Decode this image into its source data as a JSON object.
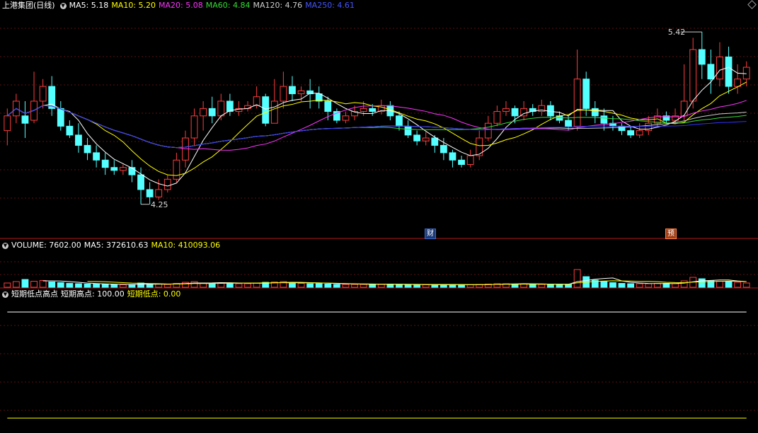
{
  "colors": {
    "up": "#ff3c3c",
    "down": "#54ffff",
    "ma5": "#ffffff",
    "ma10": "#ffff00",
    "ma20": "#ff33ff",
    "ma60": "#33dd33",
    "ma120": "#cccccc",
    "ma250": "#3333ff",
    "grid": "#5a1010",
    "axis": "#b01818"
  },
  "header": {
    "title": "上港集团(日线)",
    "ma5": "MA5: 5.18",
    "ma10": "MA10: 5.20",
    "ma20": "MA20: 5.08",
    "ma60": "MA60: 4.84",
    "ma120": "MA120: 4.76",
    "ma250": "MA250: 4.61"
  },
  "volume_header": {
    "label": "VOLUME: 7602.00",
    "ma5": "MA5: 372610.63",
    "ma10": "MA10: 410093.06"
  },
  "indicator_header": {
    "label": "短期低点高点",
    "high": "短期高点: 100.00",
    "low": "短期低点: 0.00"
  },
  "markers": {
    "cai": "财",
    "yu": "预"
  },
  "chart_data": {
    "type": "candlestick",
    "price_range": [
      4.1,
      5.55
    ],
    "high_label": "5.42",
    "low_label": "4.25",
    "candles": [
      [
        4.75,
        4.85,
        4.65,
        4.9
      ],
      [
        4.85,
        4.95,
        4.8,
        5.0
      ],
      [
        4.85,
        4.8,
        4.7,
        4.95
      ],
      [
        4.82,
        4.95,
        4.8,
        5.15
      ],
      [
        4.95,
        5.05,
        4.9,
        5.1
      ],
      [
        5.05,
        4.9,
        4.85,
        5.12
      ],
      [
        4.9,
        4.78,
        4.75,
        4.95
      ],
      [
        4.78,
        4.72,
        4.7,
        4.82
      ],
      [
        4.72,
        4.65,
        4.6,
        4.8
      ],
      [
        4.65,
        4.6,
        4.55,
        4.7
      ],
      [
        4.6,
        4.55,
        4.5,
        4.65
      ],
      [
        4.55,
        4.5,
        4.45,
        4.6
      ],
      [
        4.5,
        4.48,
        4.45,
        4.55
      ],
      [
        4.48,
        4.5,
        4.45,
        4.52
      ],
      [
        4.5,
        4.45,
        4.4,
        4.55
      ],
      [
        4.45,
        4.35,
        4.25,
        4.5
      ],
      [
        4.35,
        4.3,
        4.25,
        4.4
      ],
      [
        4.3,
        4.35,
        4.28,
        4.42
      ],
      [
        4.35,
        4.42,
        4.33,
        4.45
      ],
      [
        4.42,
        4.55,
        4.4,
        4.6
      ],
      [
        4.55,
        4.7,
        4.5,
        4.75
      ],
      [
        4.7,
        4.85,
        4.65,
        4.9
      ],
      [
        4.85,
        4.9,
        4.75,
        4.95
      ],
      [
        4.9,
        4.85,
        4.8,
        4.98
      ],
      [
        4.85,
        4.95,
        4.82,
        5.0
      ],
      [
        4.95,
        4.88,
        4.85,
        5.0
      ],
      [
        4.88,
        4.9,
        4.85,
        4.95
      ],
      [
        4.9,
        4.92,
        4.88,
        4.95
      ],
      [
        4.92,
        4.98,
        4.9,
        5.05
      ],
      [
        4.98,
        4.8,
        4.78,
        5.0
      ],
      [
        4.8,
        4.95,
        4.8,
        5.1
      ],
      [
        4.95,
        5.05,
        4.9,
        5.15
      ],
      [
        5.05,
        5.0,
        4.95,
        5.12
      ],
      [
        5.0,
        5.02,
        4.95,
        5.05
      ],
      [
        5.02,
        5.0,
        4.9,
        5.1
      ],
      [
        5.0,
        4.95,
        4.9,
        5.05
      ],
      [
        4.95,
        4.88,
        4.82,
        4.98
      ],
      [
        4.88,
        4.82,
        4.8,
        4.9
      ],
      [
        4.82,
        4.85,
        4.8,
        4.88
      ],
      [
        4.85,
        4.88,
        4.82,
        4.92
      ],
      [
        4.88,
        4.9,
        4.85,
        4.95
      ],
      [
        4.9,
        4.88,
        4.85,
        4.93
      ],
      [
        4.88,
        4.92,
        4.86,
        4.96
      ],
      [
        4.92,
        4.85,
        4.82,
        4.95
      ],
      [
        4.85,
        4.78,
        4.75,
        4.88
      ],
      [
        4.78,
        4.72,
        4.7,
        4.82
      ],
      [
        4.72,
        4.68,
        4.65,
        4.75
      ],
      [
        4.68,
        4.7,
        4.65,
        4.74
      ],
      [
        4.7,
        4.65,
        4.6,
        4.72
      ],
      [
        4.65,
        4.6,
        4.55,
        4.7
      ],
      [
        4.6,
        4.55,
        4.5,
        4.62
      ],
      [
        4.55,
        4.52,
        4.5,
        4.58
      ],
      [
        4.52,
        4.58,
        4.5,
        4.62
      ],
      [
        4.58,
        4.7,
        4.55,
        4.75
      ],
      [
        4.7,
        4.8,
        4.68,
        4.85
      ],
      [
        4.8,
        4.88,
        4.78,
        4.92
      ],
      [
        4.88,
        4.9,
        4.85,
        4.95
      ],
      [
        4.9,
        4.85,
        4.8,
        4.92
      ],
      [
        4.85,
        4.9,
        4.82,
        4.95
      ],
      [
        4.9,
        4.88,
        4.85,
        4.93
      ],
      [
        4.88,
        4.92,
        4.85,
        4.96
      ],
      [
        4.92,
        4.85,
        4.82,
        4.95
      ],
      [
        4.85,
        4.82,
        4.8,
        4.88
      ],
      [
        4.82,
        4.78,
        4.75,
        4.85
      ],
      [
        4.78,
        5.1,
        4.75,
        5.3
      ],
      [
        5.1,
        4.9,
        4.85,
        5.15
      ],
      [
        4.9,
        4.85,
        4.8,
        4.95
      ],
      [
        4.85,
        4.8,
        4.75,
        4.9
      ],
      [
        4.8,
        4.78,
        4.75,
        4.85
      ],
      [
        4.78,
        4.75,
        4.72,
        4.8
      ],
      [
        4.75,
        4.72,
        4.7,
        4.78
      ],
      [
        4.72,
        4.75,
        4.7,
        4.8
      ],
      [
        4.75,
        4.8,
        4.72,
        4.85
      ],
      [
        4.8,
        4.85,
        4.78,
        4.9
      ],
      [
        4.85,
        4.82,
        4.8,
        4.88
      ],
      [
        4.82,
        4.85,
        4.8,
        4.9
      ],
      [
        4.85,
        4.95,
        4.82,
        5.2
      ],
      [
        4.95,
        5.3,
        4.9,
        5.38
      ],
      [
        5.3,
        5.2,
        5.1,
        5.42
      ],
      [
        5.2,
        5.1,
        5.0,
        5.3
      ],
      [
        5.1,
        5.25,
        5.05,
        5.35
      ],
      [
        5.25,
        5.05,
        5.0,
        5.32
      ],
      [
        5.05,
        5.1,
        5.0,
        5.2
      ],
      [
        5.1,
        5.18,
        5.05,
        5.22
      ]
    ],
    "volume_range": [
      0,
      1000
    ],
    "volumes": [
      120,
      160,
      220,
      170,
      190,
      150,
      130,
      110,
      100,
      90,
      90,
      80,
      80,
      70,
      80,
      120,
      100,
      90,
      80,
      110,
      140,
      160,
      120,
      110,
      130,
      110,
      100,
      100,
      120,
      140,
      150,
      160,
      130,
      110,
      100,
      100,
      90,
      80,
      80,
      80,
      80,
      80,
      80,
      90,
      80,
      70,
      70,
      70,
      70,
      80,
      80,
      70,
      70,
      80,
      90,
      100,
      100,
      90,
      90,
      80,
      80,
      80,
      80,
      80,
      500,
      300,
      200,
      160,
      130,
      110,
      100,
      100,
      100,
      110,
      110,
      100,
      180,
      280,
      240,
      180,
      170,
      160,
      140,
      120
    ],
    "volume_ma5": [
      null,
      null,
      null,
      null,
      180,
      180,
      176,
      158,
      140,
      118,
      104,
      94,
      88,
      82,
      80,
      86,
      88,
      88,
      88,
      96,
      104,
      120,
      120,
      122,
      130,
      128,
      120,
      114,
      112,
      116,
      124,
      134,
      140,
      138,
      130,
      122,
      116,
      106,
      98,
      92,
      88,
      86,
      84,
      84,
      82,
      80,
      78,
      74,
      72,
      72,
      74,
      74,
      72,
      72,
      74,
      82,
      90,
      96,
      100,
      98,
      94,
      88,
      86,
      80,
      160,
      188,
      228,
      248,
      262,
      180,
      140,
      120,
      108,
      104,
      104,
      104,
      118,
      154,
      182,
      192,
      206,
      206,
      178,
      160
    ],
    "volume_ma10": [
      null,
      null,
      null,
      null,
      null,
      null,
      null,
      null,
      null,
      164,
      162,
      154,
      142,
      130,
      118,
      112,
      106,
      100,
      92,
      92,
      94,
      104,
      104,
      106,
      110,
      116,
      116,
      120,
      120,
      124,
      128,
      128,
      128,
      126,
      124,
      122,
      118,
      112,
      104,
      98,
      94,
      92,
      88,
      88,
      88,
      84,
      82,
      80,
      80,
      80,
      80,
      78,
      76,
      76,
      78,
      80,
      84,
      86,
      88,
      88,
      88,
      88,
      88,
      88,
      124,
      144,
      164,
      176,
      182,
      178,
      174,
      166,
      164,
      158,
      140,
      132,
      130,
      144,
      156,
      160,
      168,
      172,
      168,
      160
    ],
    "indicator_range": [
      -10,
      110
    ],
    "indicator_high": [
      100,
      100,
      100,
      100,
      100,
      100,
      100,
      100,
      100,
      100,
      100,
      100,
      100,
      100,
      100,
      100,
      100,
      100,
      100,
      100,
      100,
      100,
      100,
      100,
      100,
      100,
      100,
      100,
      100,
      100,
      100,
      100,
      100,
      100,
      100,
      100,
      100,
      100,
      100,
      100,
      100,
      100,
      100,
      100,
      100,
      100,
      100,
      100,
      100,
      100,
      100,
      100,
      100,
      100,
      100,
      100,
      100,
      100,
      100,
      100,
      100,
      100,
      100,
      100,
      100,
      100,
      100,
      100,
      100,
      100,
      100,
      100,
      100,
      100,
      100,
      100,
      100,
      100,
      100,
      100,
      100,
      100,
      100,
      100
    ],
    "indicator_low": [
      0,
      0,
      0,
      0,
      0,
      0,
      0,
      0,
      0,
      0,
      0,
      0,
      0,
      0,
      0,
      0,
      0,
      0,
      0,
      0,
      0,
      0,
      0,
      0,
      0,
      0,
      0,
      0,
      0,
      0,
      0,
      0,
      0,
      0,
      0,
      0,
      0,
      0,
      0,
      0,
      0,
      0,
      0,
      0,
      0,
      0,
      0,
      0,
      0,
      0,
      0,
      0,
      0,
      0,
      0,
      0,
      0,
      0,
      0,
      0,
      0,
      0,
      0,
      0,
      0,
      0,
      0,
      0,
      0,
      0,
      0,
      0,
      0,
      0,
      0,
      0,
      0,
      0,
      0,
      0,
      0,
      0,
      0,
      0
    ]
  }
}
